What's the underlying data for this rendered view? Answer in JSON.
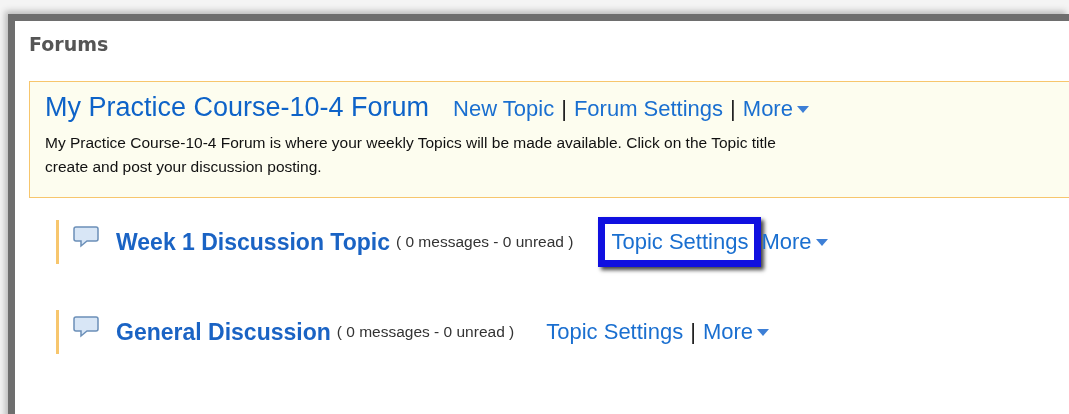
{
  "page": {
    "title": "Forums"
  },
  "forum": {
    "title": "My Practice Course-10-4 Forum",
    "links": [
      {
        "kind": "link",
        "label": "New Topic"
      },
      {
        "kind": "separator",
        "label": "|"
      },
      {
        "kind": "link",
        "label": "Forum Settings"
      },
      {
        "kind": "separator",
        "label": "|"
      },
      {
        "kind": "menu",
        "label": "More"
      }
    ],
    "description": [
      "My Practice Course-10-4 Forum is where your weekly Topics will be made available. Click on the Topic title",
      "create and post your discussion posting."
    ]
  },
  "topics": [
    {
      "title": "Week 1 Discussion Topic",
      "counts": "( 0 messages - 0 unread )",
      "actions": [
        {
          "kind": "link",
          "label": "Topic Settings",
          "highlighted": true
        },
        {
          "kind": "menu",
          "label": "More"
        }
      ]
    },
    {
      "title": "General Discussion",
      "counts": "( 0 messages - 0 unread )",
      "actions": [
        {
          "kind": "link",
          "label": "Topic Settings",
          "highlighted": false
        },
        {
          "kind": "separator",
          "label": "|"
        },
        {
          "kind": "menu",
          "label": "More"
        }
      ]
    }
  ]
}
